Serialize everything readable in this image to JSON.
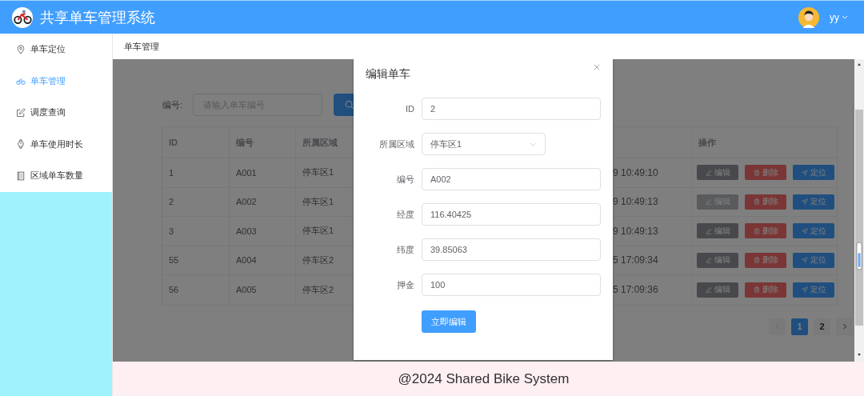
{
  "header": {
    "title": "共享单车管理系统",
    "user": {
      "name": "yy"
    }
  },
  "sidebar": {
    "items": [
      {
        "label": "单车定位",
        "selected": false
      },
      {
        "label": "单车管理",
        "selected": true
      },
      {
        "label": "调度查询",
        "selected": false
      },
      {
        "label": "单车使用时长",
        "selected": false
      },
      {
        "label": "区域单车数量",
        "selected": false
      }
    ]
  },
  "breadcrumb": "单车管理",
  "search": {
    "label": "编号:",
    "placeholder": "请输入单车编号"
  },
  "table": {
    "columns": [
      "ID",
      "编号",
      "所属区域",
      "操作"
    ],
    "rows": [
      {
        "id": "1",
        "code": "A001",
        "area": "停车区1",
        "time": "9 10:49:10",
        "actions": [
          {
            "kind": "edit",
            "label": "编辑",
            "hovered": false
          },
          {
            "kind": "delete",
            "label": "删除"
          },
          {
            "kind": "locate",
            "label": "定位"
          }
        ]
      },
      {
        "id": "2",
        "code": "A002",
        "area": "停车区1",
        "time": "9 10:49:13",
        "actions": [
          {
            "kind": "edit",
            "label": "编辑",
            "hovered": true
          },
          {
            "kind": "delete",
            "label": "删除"
          },
          {
            "kind": "locate",
            "label": "定位"
          }
        ]
      },
      {
        "id": "3",
        "code": "A003",
        "area": "停车区1",
        "time": "9 10:49:13",
        "actions": [
          {
            "kind": "edit",
            "label": "编辑",
            "hovered": false
          },
          {
            "kind": "delete",
            "label": "删除"
          },
          {
            "kind": "locate",
            "label": "定位"
          }
        ]
      },
      {
        "id": "55",
        "code": "A004",
        "area": "停车区2",
        "time": "5 17:09:34",
        "actions": [
          {
            "kind": "edit",
            "label": "编辑",
            "hovered": false
          },
          {
            "kind": "delete",
            "label": "删除"
          },
          {
            "kind": "locate",
            "label": "定位"
          }
        ]
      },
      {
        "id": "56",
        "code": "A005",
        "area": "停车区2",
        "time": "5 17:09:36",
        "actions": [
          {
            "kind": "edit",
            "label": "编辑",
            "hovered": false
          },
          {
            "kind": "delete",
            "label": "删除"
          },
          {
            "kind": "locate",
            "label": "定位"
          }
        ]
      }
    ]
  },
  "pagination": {
    "prev_disabled": true,
    "pages": [
      {
        "label": "1",
        "selected": true
      },
      {
        "label": "2",
        "selected": false
      }
    ]
  },
  "dialog": {
    "title": "编辑单车",
    "fields": [
      {
        "kind": "input",
        "label": "ID",
        "value": "2"
      },
      {
        "kind": "select",
        "label": "所属区域",
        "value": "停车区1"
      },
      {
        "kind": "input",
        "label": "编号",
        "value": "A002"
      },
      {
        "kind": "input",
        "label": "经度",
        "value": "116.40425"
      },
      {
        "kind": "input",
        "label": "纬度",
        "value": "39.85063"
      },
      {
        "kind": "input",
        "label": "押金",
        "value": "100"
      }
    ],
    "submit": "立即编辑"
  },
  "footer": "@2024 Shared Bike System"
}
